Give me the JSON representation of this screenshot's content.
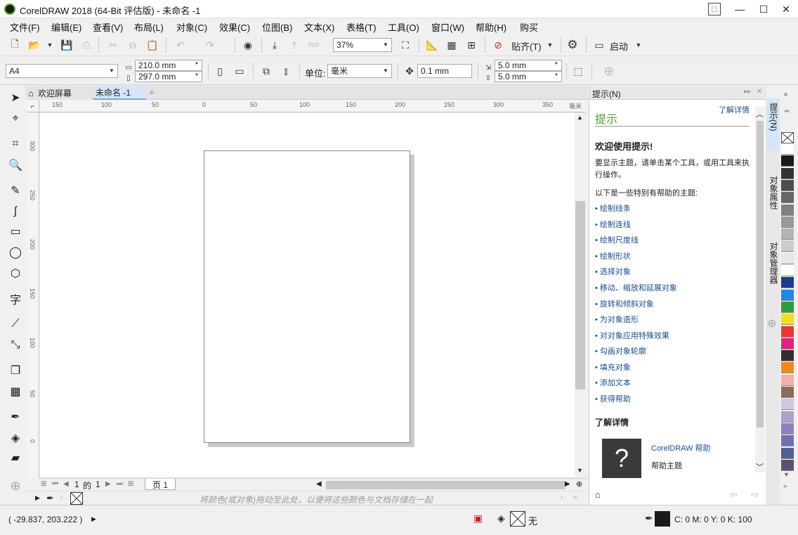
{
  "window": {
    "title": "CorelDRAW 2018 (64-Bit 评估版) - 未命名 -1",
    "min": "—",
    "max": "☐",
    "close": "✕"
  },
  "menu": [
    "文件(F)",
    "编辑(E)",
    "查看(V)",
    "布局(L)",
    "对象(C)",
    "效果(C)",
    "位图(B)",
    "文本(X)",
    "表格(T)",
    "工具(O)",
    "窗口(W)",
    "帮助(H)",
    "购买"
  ],
  "toolbar": {
    "zoom": "37%",
    "snap": "贴齐(T)",
    "launch": "启动"
  },
  "propbar": {
    "page_size": "A4",
    "width": "210.0 mm",
    "height": "297.0 mm",
    "unit_label": "单位:",
    "unit": "毫米",
    "nudge": "0.1 mm",
    "dup_x": "5.0 mm",
    "dup_y": "5.0 mm"
  },
  "tabs": {
    "welcome": "欢迎屏幕",
    "doc": "未命名 -1"
  },
  "ruler": {
    "h": [
      "150",
      "100",
      "50",
      "0",
      "50",
      "100",
      "150",
      "200",
      "250",
      "300",
      "350",
      "毫米"
    ],
    "v": [
      "300",
      "250",
      "200",
      "150",
      "100",
      "50",
      "0"
    ]
  },
  "pagenav": {
    "current": "1",
    "of": "的",
    "total": "1",
    "page_tab": "页 1"
  },
  "docpalette_hint": "将颜色(或对象)拖动至此处，以便将这些颜色与文档存储在一起",
  "status": {
    "coords": "( -29.837, 203.222 )",
    "fill_none": "无",
    "outline": "C: 0 M: 0 Y: 0 K: 100"
  },
  "docker": {
    "header": "提示(N)",
    "title": "提示",
    "learn_more": "了解详情",
    "welcome": "欢迎使用提示!",
    "intro": "要显示主题，请单击某个工具，或用工具来执行操作。",
    "topics_label": "以下是一些特别有帮助的主题:",
    "topics": [
      "绘制线条",
      "绘制连线",
      "绘制尺度线",
      "绘制形状",
      "选择对象",
      "移动、缩放和延展对象",
      "旋转和倾斜对象",
      "为对象造形",
      "对对象应用特殊效果",
      "勾画对象轮廓",
      "填充对象",
      "添加文本",
      "获得帮助"
    ],
    "details_title": "了解详情",
    "help_link": "CorelDRAW 帮助",
    "help_topic": "帮助主题"
  },
  "sidetabs": [
    "提示(N)",
    "对象属性",
    "对象管理器"
  ],
  "palette": [
    "#ffffff",
    "#1a1a1a",
    "#333333",
    "#4d4d4d",
    "#666666",
    "#808080",
    "#999999",
    "#b3b3b3",
    "#cccccc",
    "#e6e6e6",
    "#ffffff",
    "#1f3a93",
    "#1e88e5",
    "#2e9c3a",
    "#f0e020",
    "#e53935",
    "#e0237a",
    "#2f2f2f",
    "#f08a1e",
    "#f4b0a8",
    "#8a6e5a",
    "#d0c8e0",
    "#b0a0c8",
    "#9080c0",
    "#7070b0",
    "#506090",
    "#605070"
  ]
}
